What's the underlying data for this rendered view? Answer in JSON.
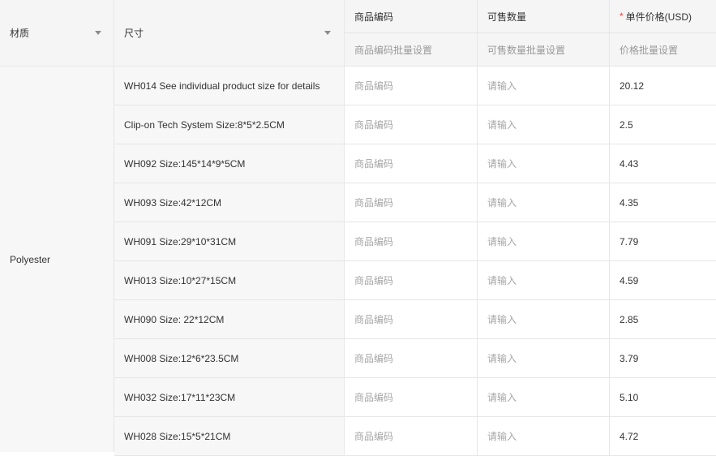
{
  "headers": {
    "material": "材质",
    "size": "尺寸",
    "sku": "商品编码",
    "qty": "可售数量",
    "price_required_mark": "*",
    "price": "单件价格(USD)"
  },
  "bulk": {
    "sku": "商品编码批量设置",
    "qty": "可售数量批量设置",
    "price": "价格批量设置"
  },
  "material_value": "Polyester",
  "placeholders": {
    "sku": "商品编码",
    "qty": "请输入"
  },
  "rows": [
    {
      "size": "WH014 See individual product size for details",
      "price": "20.12"
    },
    {
      "size": "Clip-on Tech System Size:8*5*2.5CM",
      "price": "2.5"
    },
    {
      "size": "WH092 Size:145*14*9*5CM",
      "price": "4.43"
    },
    {
      "size": "WH093 Size:42*12CM",
      "price": "4.35"
    },
    {
      "size": "WH091 Size:29*10*31CM",
      "price": "7.79"
    },
    {
      "size": "WH013 Size:10*27*15CM",
      "price": "4.59"
    },
    {
      "size": "WH090 Size: 22*12CM",
      "price": "2.85"
    },
    {
      "size": "WH008 Size:12*6*23.5CM",
      "price": "3.79"
    },
    {
      "size": "WH032 Size:17*11*23CM",
      "price": "5.10"
    },
    {
      "size": "WH028 Size:15*5*21CM",
      "price": "4.72"
    }
  ]
}
